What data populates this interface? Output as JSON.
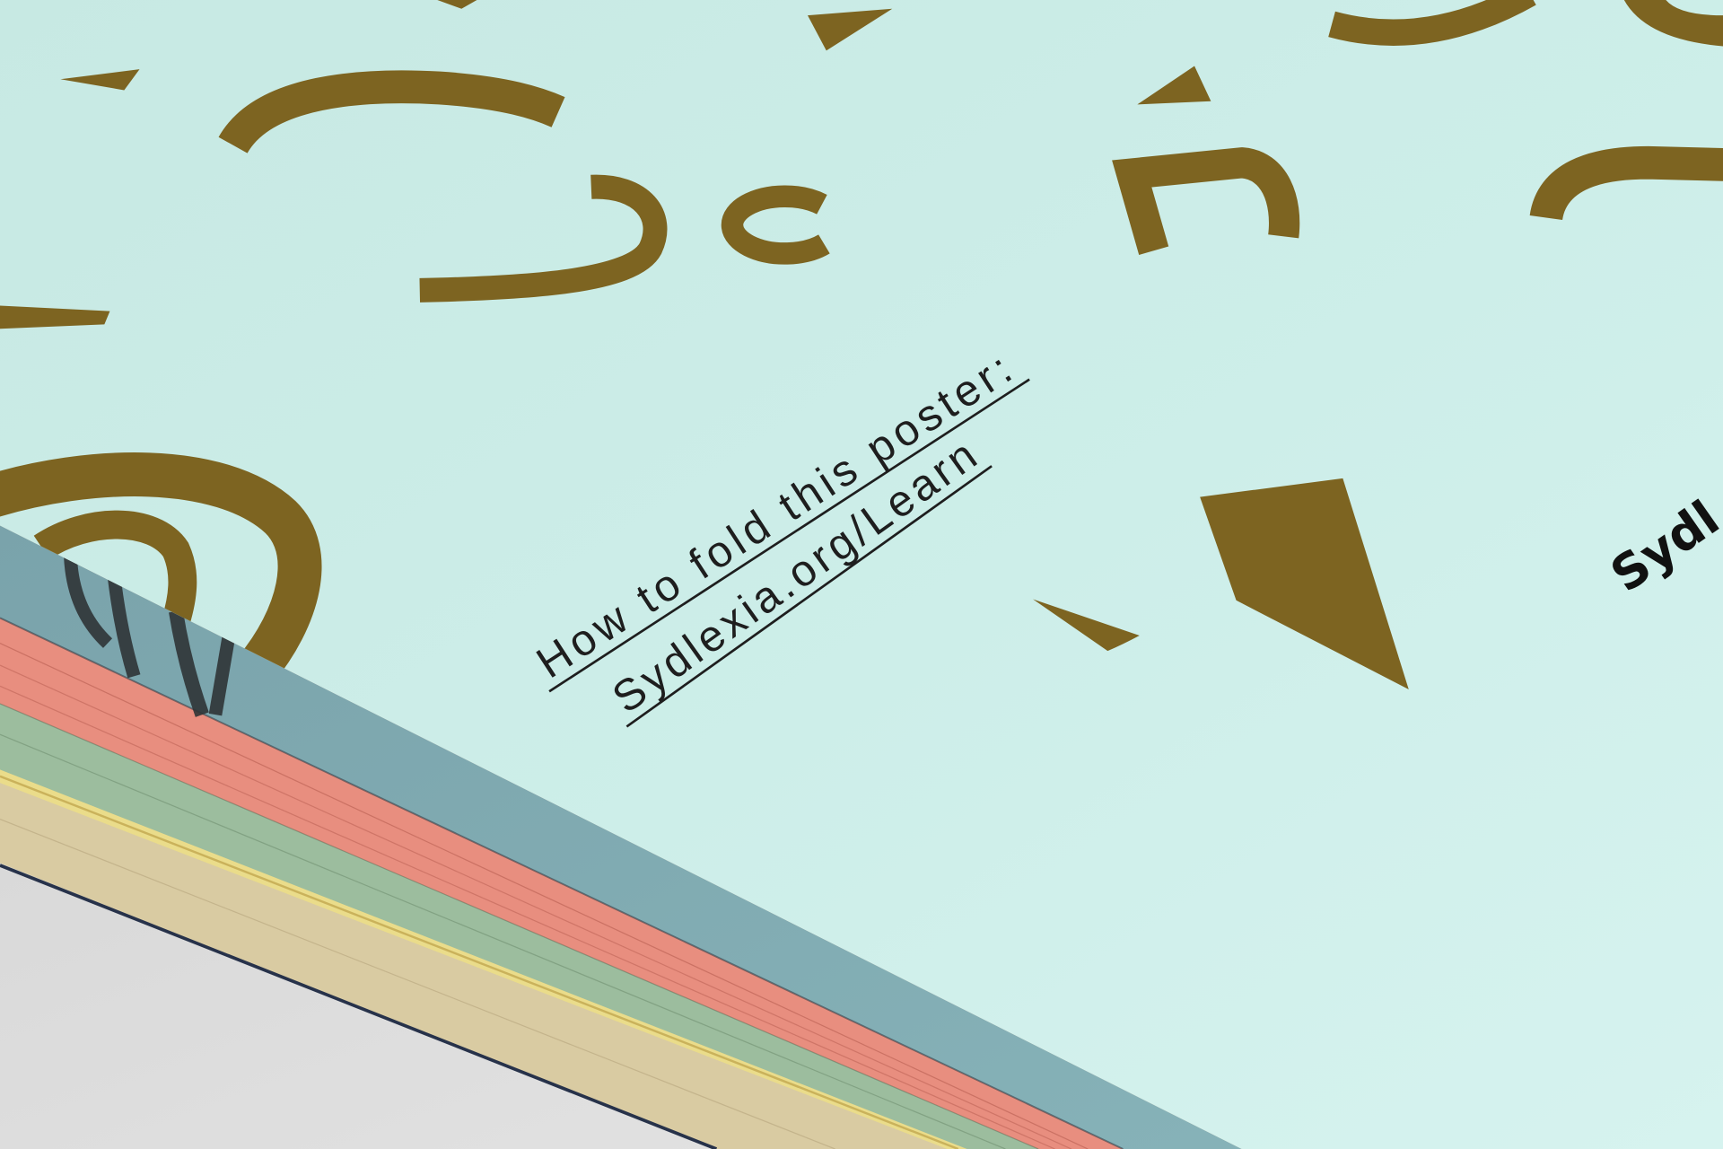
{
  "poster": {
    "instruction_line": "How to fold this poster:",
    "url_line": "Sydlexia.org/Learn",
    "brand_fragment": "Sydl"
  },
  "palette": {
    "paper": "#cdeee9",
    "gold": "#7d6421",
    "ink": "#1e1e1e",
    "teal": "#7ba5ac",
    "pink": "#e88e7f",
    "green": "#9cbd9e",
    "yellow": "#eadc8a",
    "beige": "#d9cba2",
    "table": "#d9d9d9"
  }
}
